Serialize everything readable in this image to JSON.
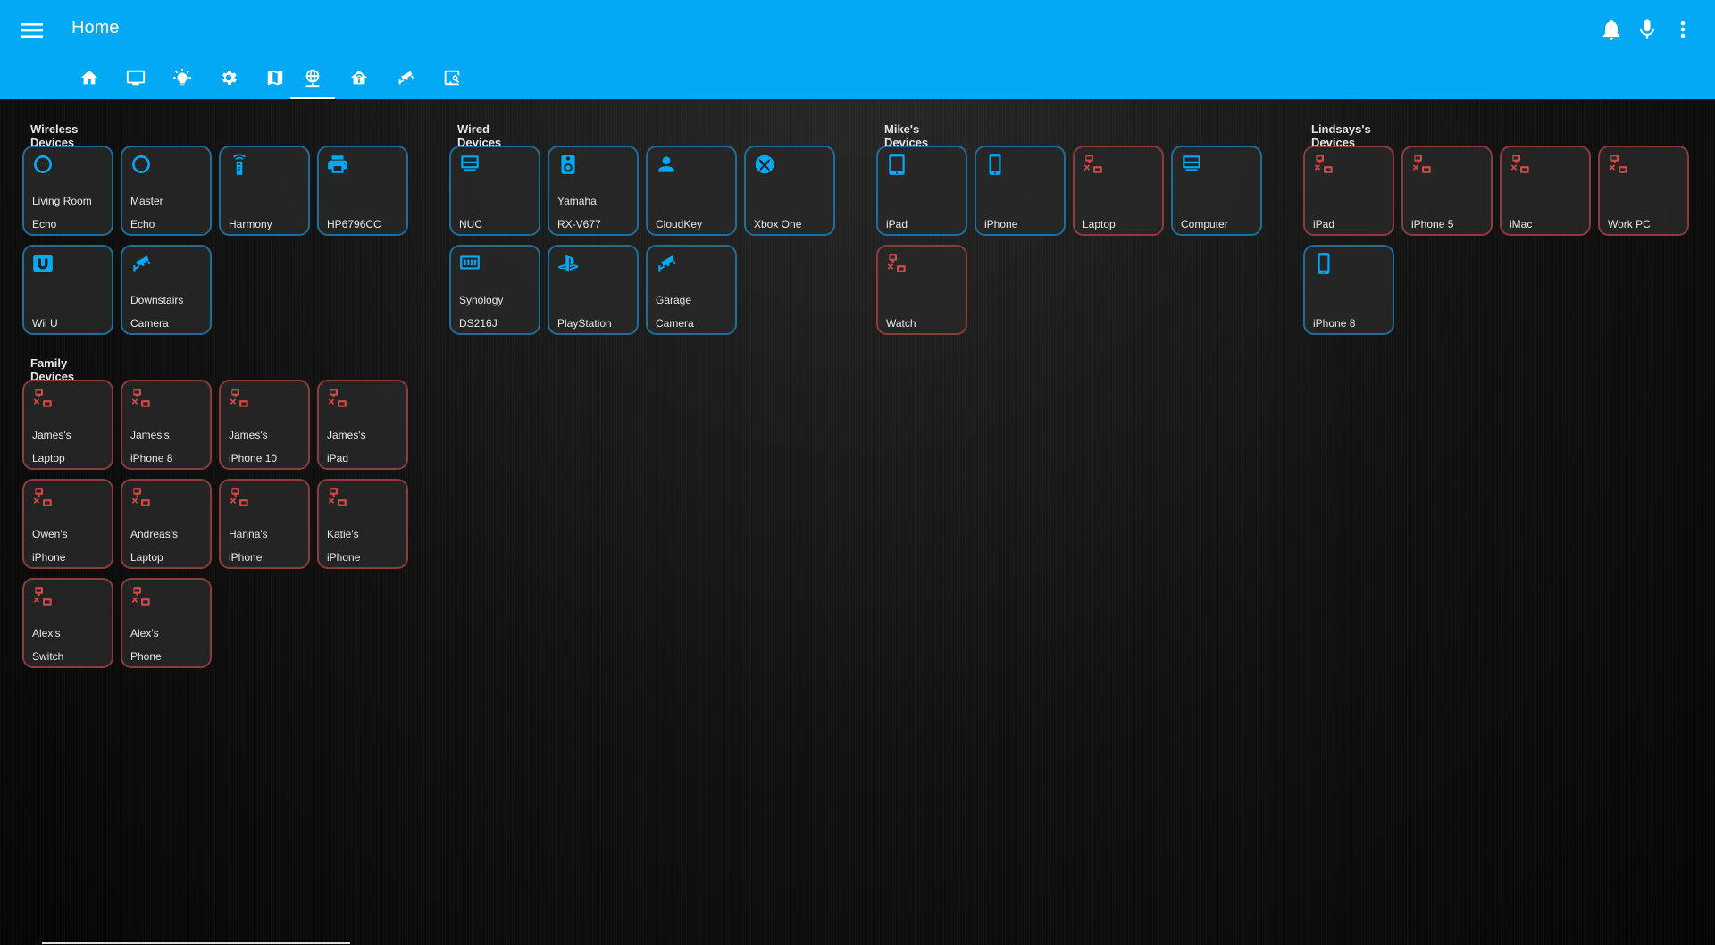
{
  "app": {
    "title": "Home"
  },
  "colors": {
    "header": "#03a9f4",
    "home_icon": "#03a9f4",
    "away_icon": "#d04a4a",
    "home_border": "#1f6e99",
    "away_border": "#8e3b3b"
  },
  "header_icons": [
    "menu-icon",
    "bell-icon",
    "microphone-icon",
    "more-vertical-icon"
  ],
  "tabs": [
    {
      "icon": "home-icon"
    },
    {
      "icon": "television-icon"
    },
    {
      "icon": "lightbulb-icon"
    },
    {
      "icon": "settings-icon"
    },
    {
      "icon": "map-icon"
    },
    {
      "icon": "web-icon",
      "active": true
    },
    {
      "icon": "home-automation-icon"
    },
    {
      "icon": "cctv-icon"
    },
    {
      "icon": "image-search-icon"
    }
  ],
  "sections": {
    "wireless": {
      "title": "Wireless Devices",
      "tiles": [
        {
          "line1": "Living Room",
          "line2": "Echo",
          "icon": "amazon-echo-icon",
          "state": "home"
        },
        {
          "line1": "Master",
          "line2": "Echo",
          "icon": "amazon-echo-icon",
          "state": "home"
        },
        {
          "line1": "",
          "line2": "Harmony",
          "icon": "remote-icon",
          "state": "home"
        },
        {
          "line1": "",
          "line2": "HP6796CC",
          "icon": "printer-icon",
          "state": "home"
        },
        {
          "line1": "",
          "line2": "Wii U",
          "icon": "nintendo-wiiu-icon",
          "state": "home"
        },
        {
          "line1": "Downstairs",
          "line2": "Camera",
          "icon": "cctv-icon",
          "state": "home"
        }
      ]
    },
    "wired": {
      "title": "Wired Devices",
      "tiles": [
        {
          "line1": "",
          "line2": "NUC",
          "icon": "desktop-tower-icon",
          "state": "home"
        },
        {
          "line1": "Yamaha",
          "line2": "RX-V677",
          "icon": "speaker-icon",
          "state": "home"
        },
        {
          "line1": "",
          "line2": "CloudKey",
          "icon": "account-icon",
          "state": "home"
        },
        {
          "line1": "",
          "line2": "Xbox One",
          "icon": "xbox-icon",
          "state": "home"
        },
        {
          "line1": "Synology",
          "line2": "DS216J",
          "icon": "nas-icon",
          "state": "home"
        },
        {
          "line1": "",
          "line2": "PlayStation",
          "icon": "playstation-icon",
          "state": "home"
        },
        {
          "line1": "Garage",
          "line2": "Camera",
          "icon": "cctv-icon",
          "state": "home"
        }
      ]
    },
    "mikes": {
      "title": "Mike's Devices",
      "tiles": [
        {
          "line1": "",
          "line2": "iPad",
          "icon": "tablet-icon",
          "state": "home"
        },
        {
          "line1": "",
          "line2": "iPhone",
          "icon": "cellphone-icon",
          "state": "home"
        },
        {
          "line1": "",
          "line2": "Laptop",
          "icon": "lan-disconnect-icon",
          "state": "away"
        },
        {
          "line1": "",
          "line2": "Computer",
          "icon": "desktop-tower-icon",
          "state": "home"
        },
        {
          "line1": "",
          "line2": "Watch",
          "icon": "lan-disconnect-icon",
          "state": "away"
        }
      ]
    },
    "lindsays": {
      "title": "Lindsays's Devices",
      "tiles": [
        {
          "line1": "",
          "line2": "iPad",
          "icon": "lan-disconnect-icon",
          "state": "away"
        },
        {
          "line1": "",
          "line2": "iPhone 5",
          "icon": "lan-disconnect-icon",
          "state": "away"
        },
        {
          "line1": "",
          "line2": "iMac",
          "icon": "lan-disconnect-icon",
          "state": "away"
        },
        {
          "line1": "",
          "line2": "Work PC",
          "icon": "lan-disconnect-icon",
          "state": "away"
        },
        {
          "line1": "",
          "line2": "iPhone 8",
          "icon": "cellphone-icon",
          "state": "home"
        }
      ]
    },
    "family": {
      "title": "Family Devices",
      "tiles": [
        {
          "line1": "James's",
          "line2": "Laptop",
          "icon": "lan-disconnect-icon",
          "state": "away"
        },
        {
          "line1": "James's",
          "line2": "iPhone 8",
          "icon": "lan-disconnect-icon",
          "state": "away"
        },
        {
          "line1": "James's",
          "line2": "iPhone 10",
          "icon": "lan-disconnect-icon",
          "state": "away"
        },
        {
          "line1": "James's",
          "line2": "iPad",
          "icon": "lan-disconnect-icon",
          "state": "away"
        },
        {
          "line1": "Owen's",
          "line2": "iPhone",
          "icon": "lan-disconnect-icon",
          "state": "away"
        },
        {
          "line1": "Andreas's",
          "line2": "Laptop",
          "icon": "lan-disconnect-icon",
          "state": "away"
        },
        {
          "line1": "Hanna's",
          "line2": "iPhone",
          "icon": "lan-disconnect-icon",
          "state": "away"
        },
        {
          "line1": "Katie's",
          "line2": "iPhone",
          "icon": "lan-disconnect-icon",
          "state": "away"
        },
        {
          "line1": "Alex's",
          "line2": "Switch",
          "icon": "lan-disconnect-icon",
          "state": "away"
        },
        {
          "line1": "Alex's",
          "line2": "Phone",
          "icon": "lan-disconnect-icon",
          "state": "away"
        }
      ]
    }
  }
}
